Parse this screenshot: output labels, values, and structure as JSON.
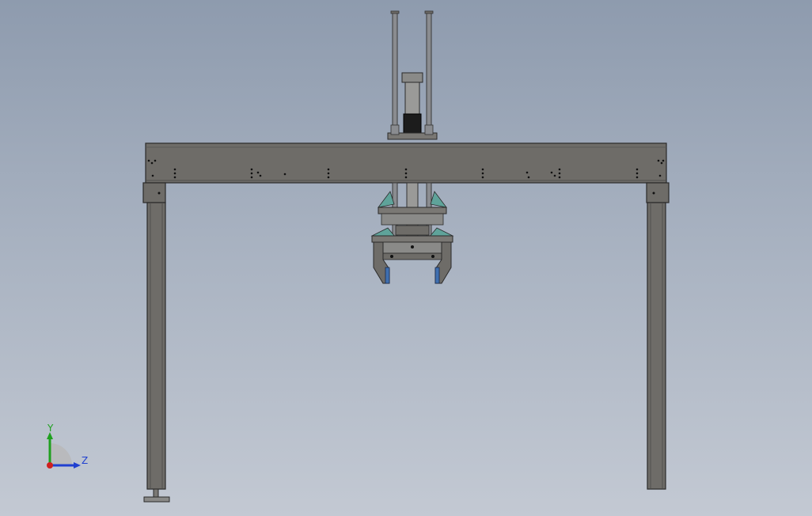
{
  "viewport": {
    "background_top": "#8e9bae",
    "background_bottom": "#c3c9d3"
  },
  "model": {
    "frame_color": "#6e6c68",
    "frame_edge_color": "#2a2a2a",
    "rod_color": "#8a8c90",
    "accent_color": "#5fa39a",
    "gripper_inner_color": "#3f6fb0",
    "motor_color": "#1c1c1c"
  },
  "triad": {
    "y_label": "Y",
    "z_label": "Z",
    "y_color": "#1fa01f",
    "z_color": "#2040d0",
    "x_color": "#d02020"
  }
}
